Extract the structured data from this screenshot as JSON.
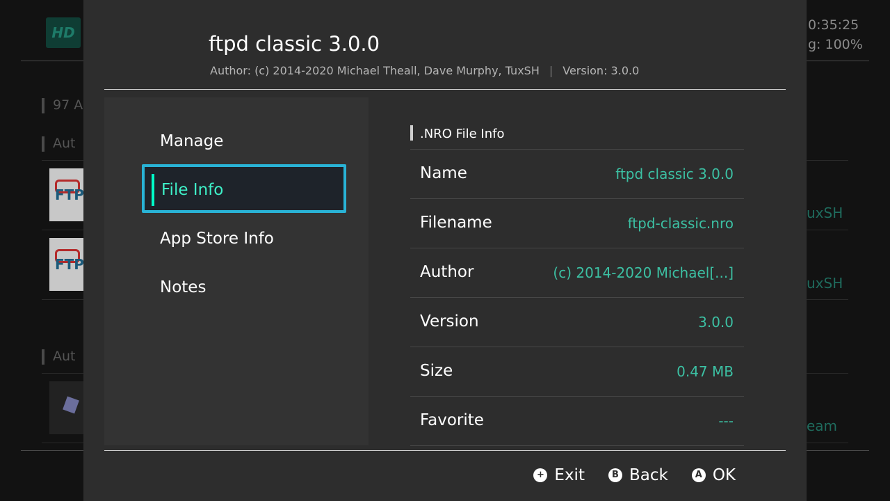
{
  "background": {
    "logo_text": "HD",
    "clock": "0:35:25",
    "battery": "g: 100%",
    "section1": "97 A",
    "section2": "Aut",
    "section3": "Aut",
    "icon_text": "FTP",
    "right_teal_1": "uxSH",
    "right_teal_2": "uxSH",
    "right_teal_3": "eam"
  },
  "dialog": {
    "title": "ftpd classic 3.0.0",
    "subtitle_author": "Author: (c) 2014-2020 Michael Theall, Dave Murphy, TuxSH",
    "subtitle_sep": "|",
    "subtitle_version": "Version: 3.0.0"
  },
  "sidebar": {
    "items": [
      {
        "label": "Manage"
      },
      {
        "label": "File Info"
      },
      {
        "label": "App Store Info"
      },
      {
        "label": "Notes"
      }
    ],
    "selected_index": 1
  },
  "file_info": {
    "header": ".NRO File Info",
    "rows": [
      {
        "key": "Name",
        "value": "ftpd classic 3.0.0"
      },
      {
        "key": "Filename",
        "value": "ftpd-classic.nro"
      },
      {
        "key": "Author",
        "value": "(c) 2014-2020 Michael[...]"
      },
      {
        "key": "Version",
        "value": "3.0.0"
      },
      {
        "key": "Size",
        "value": "0.47 MB"
      },
      {
        "key": "Favorite",
        "value": "---"
      }
    ]
  },
  "footer": {
    "exit": {
      "icon": "plus-button-icon",
      "glyph": "+",
      "label": "Exit"
    },
    "back": {
      "icon": "b-button-icon",
      "glyph": "B",
      "label": "Back"
    },
    "ok": {
      "icon": "a-button-icon",
      "glyph": "A",
      "label": "OK"
    }
  },
  "colors": {
    "accent_text": "#3cc0a3",
    "selection_border": "#29b3d6",
    "selection_bar": "#00ffc8",
    "dialog_bg": "#2d2d2d"
  }
}
